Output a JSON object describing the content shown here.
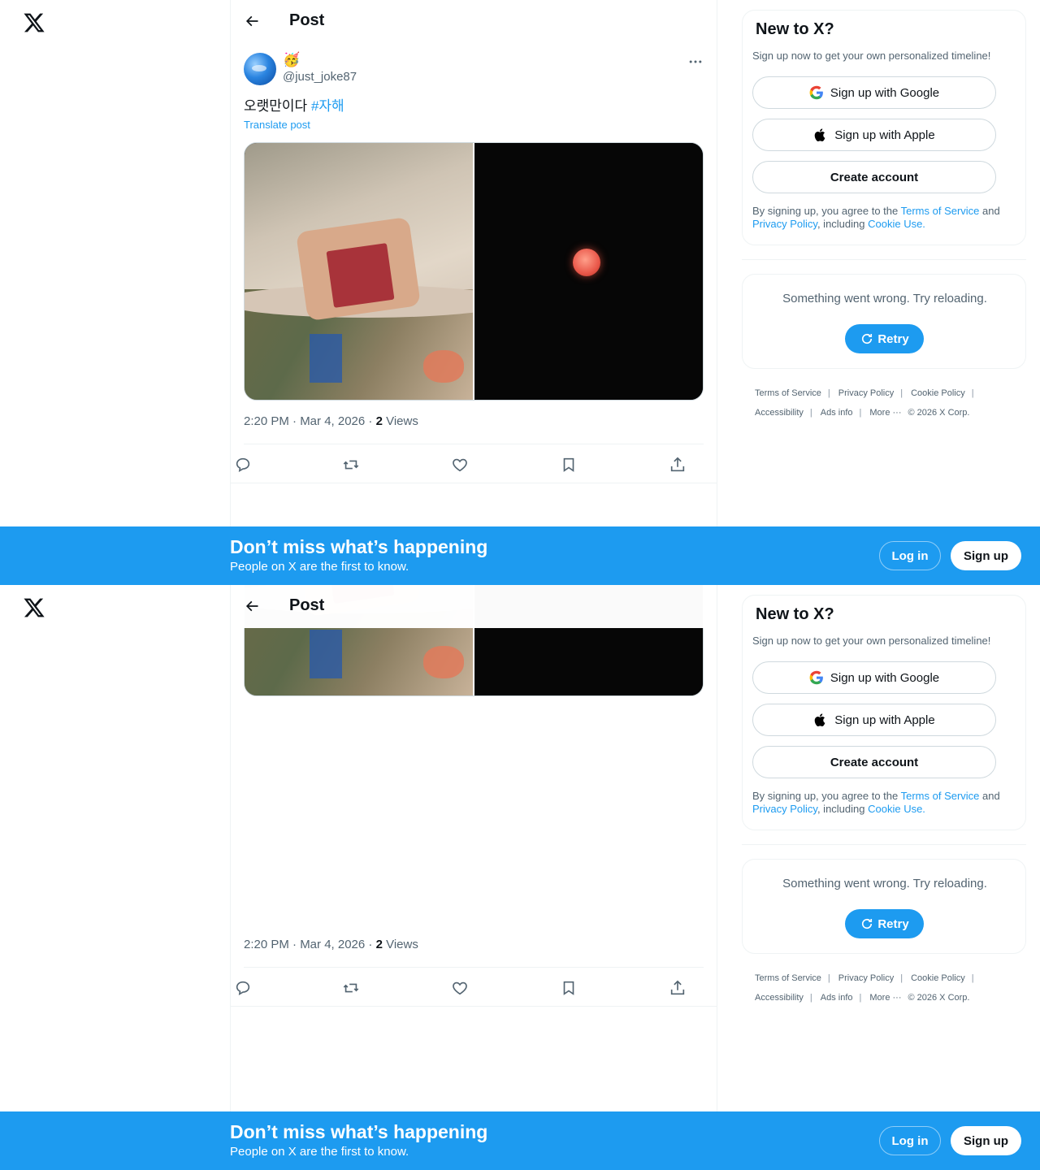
{
  "header": {
    "title": "Post"
  },
  "post": {
    "emoji": "🥳",
    "handle": "@just_joke87",
    "text": "오랫만이다",
    "hashtag": "#자해",
    "translate": "Translate post",
    "time": "2:20 PM · Mar 4, 2026 · ",
    "views_count": "2",
    "views_label": " Views"
  },
  "signup": {
    "title": "New to X?",
    "subtitle": "Sign up now to get your own personalized timeline!",
    "google": "Sign up with Google",
    "apple": "Sign up with Apple",
    "create": "Create account",
    "legal_prefix": "By signing up, you agree to the ",
    "terms": "Terms of Service",
    "and": " and ",
    "privacy": "Privacy Policy",
    "including": ", including ",
    "cookie": "Cookie Use."
  },
  "error": {
    "message": "Something went wrong. Try reloading.",
    "retry": "Retry"
  },
  "footer": {
    "terms": "Terms of Service",
    "privacy": "Privacy Policy",
    "cookie": "Cookie Policy",
    "accessibility": "Accessibility",
    "ads": "Ads info",
    "more": "More ···",
    "copyright": "© 2026 X Corp.",
    "sep": "|"
  },
  "banner": {
    "title": "Don’t miss what’s happening",
    "subtitle": "People on X are the first to know.",
    "login": "Log in",
    "signup": "Sign up"
  },
  "colors": {
    "accent": "#1d9bf0",
    "text": "#0f1419",
    "muted": "#536471"
  }
}
